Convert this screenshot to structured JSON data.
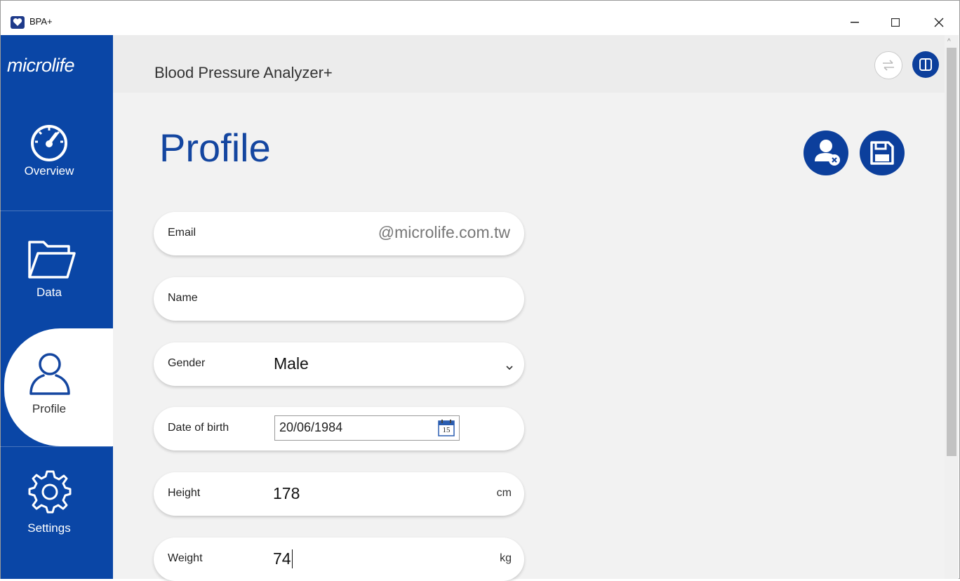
{
  "window": {
    "title": "BPA+"
  },
  "sidebar": {
    "logo": "microlife",
    "items": [
      {
        "label": "Overview"
      },
      {
        "label": "Data"
      },
      {
        "label": "Profile"
      },
      {
        "label": "Settings"
      }
    ]
  },
  "header": {
    "app_name": "Blood Pressure Analyzer+"
  },
  "page": {
    "title": "Profile"
  },
  "form": {
    "email": {
      "label": "Email",
      "value": "@microlife.com.tw"
    },
    "name": {
      "label": "Name",
      "value": ""
    },
    "gender": {
      "label": "Gender",
      "value": "Male"
    },
    "dob": {
      "label": "Date of birth",
      "value": "20/06/1984",
      "calendar_day": "15"
    },
    "height": {
      "label": "Height",
      "value": "178",
      "unit": "cm"
    },
    "weight": {
      "label": "Weight",
      "value": "74",
      "unit": "kg"
    }
  },
  "colors": {
    "brand_blue": "#0a46a6",
    "accent_blue": "#1446a0"
  }
}
